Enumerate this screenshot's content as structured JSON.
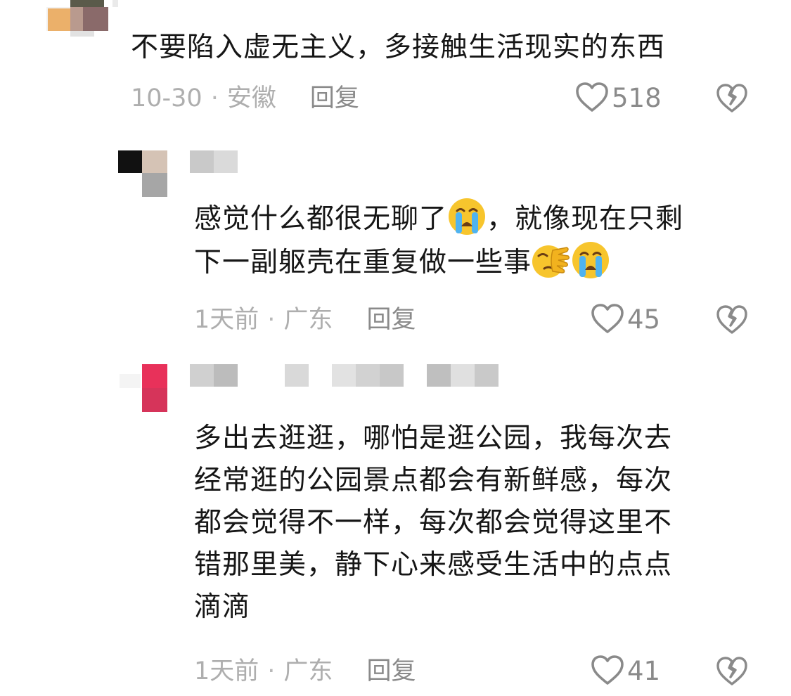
{
  "comments": [
    {
      "text": "不要陷入虚无主义，多接触生活现实的东西",
      "date": "10-30",
      "location": "安徽",
      "reply_label": "回复",
      "likes": "518",
      "icons": [
        "heart-icon",
        "broken-heart-icon"
      ]
    },
    {
      "text_part1": "感觉什么都很无聊了",
      "text_part2": "，就像现在只剩\n下一副躯壳在重复做一些事",
      "emojis": [
        "loudly-crying-emoji",
        "face-palm-emoji",
        "loudly-crying-emoji"
      ],
      "date": "1天前",
      "location": "广东",
      "reply_label": "回复",
      "likes": "45",
      "icons": [
        "heart-icon",
        "broken-heart-icon"
      ]
    },
    {
      "text": "多出去逛逛，哪怕是逛公园，我每次去\n经常逛的公园景点都会有新鲜感，每次\n都会觉得不一样，每次都会觉得这里不\n错那里美，静下心来感受生活中的点点\n滴滴",
      "date": "1天前",
      "location": "广东",
      "reply_label": "回复",
      "likes": "41",
      "icons": [
        "heart-icon",
        "broken-heart-icon"
      ]
    }
  ],
  "separator": "·",
  "colors": {
    "text": "#161616",
    "meta": "#aeaeae",
    "reply": "#8a8a8a",
    "avatar_accent": "#e8315a",
    "emoji_yellow": "#f7c52d"
  }
}
